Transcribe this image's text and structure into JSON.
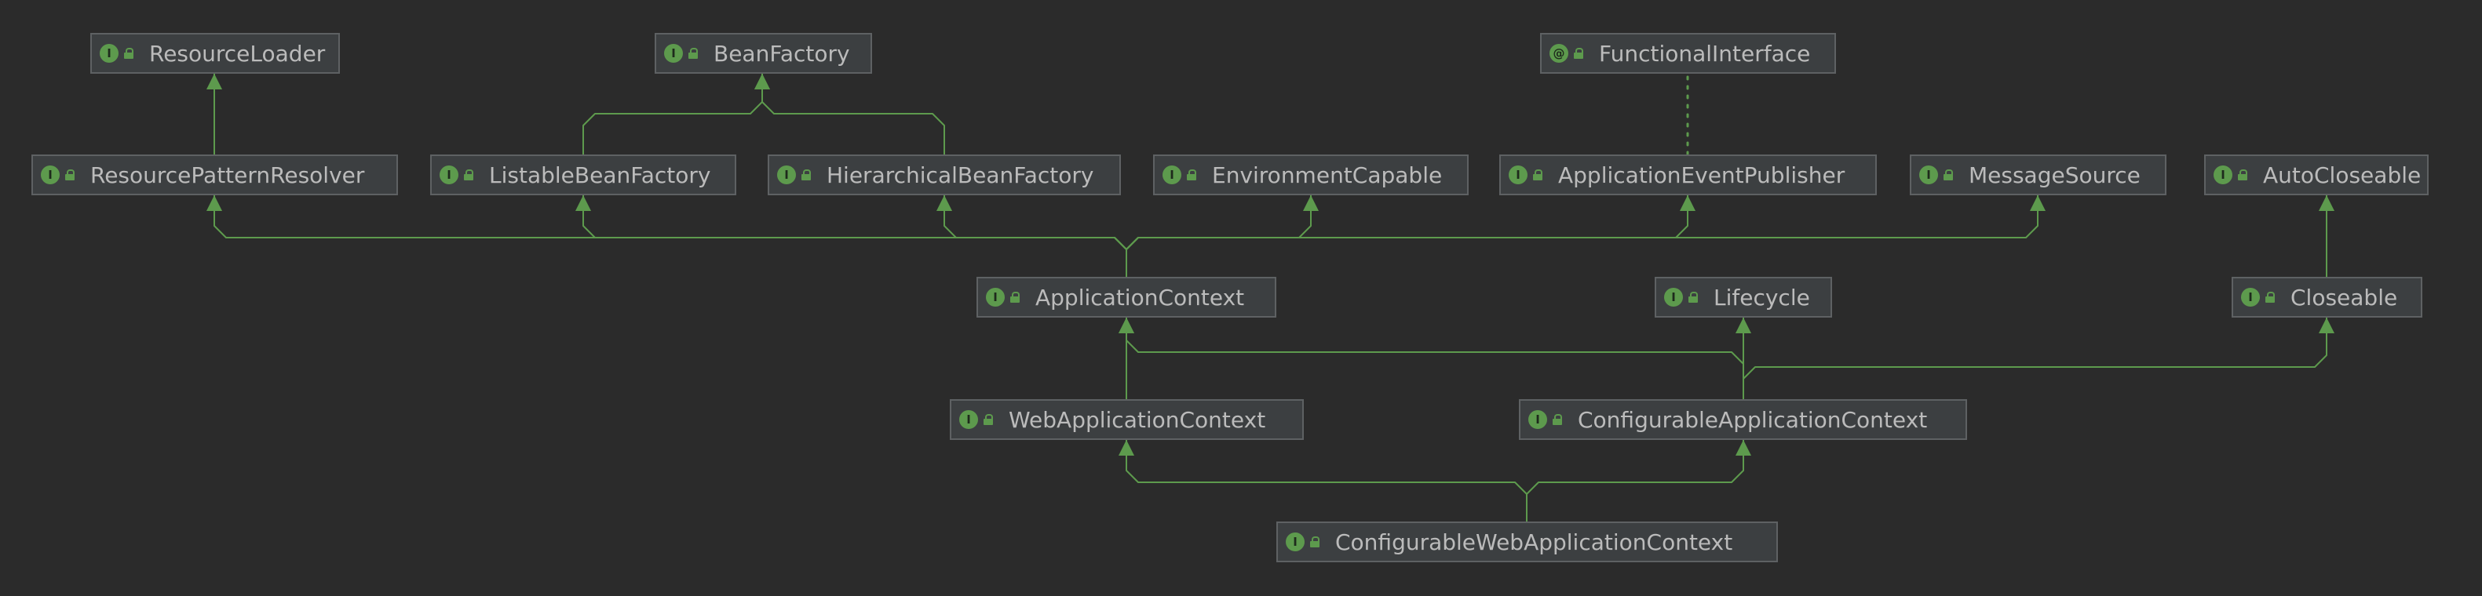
{
  "colors": {
    "background": "#2b2b2b",
    "node_fill": "#3c3f41",
    "node_border": "#5e6163",
    "text": "#bbbbbb",
    "edge": "#5d9a4d",
    "badge": "#5d9a4d"
  },
  "nodes": [
    {
      "id": "resource-loader",
      "label": "ResourceLoader",
      "badge": "I",
      "badge_icon": "interface-icon",
      "visibility_icon": "lock-icon"
    },
    {
      "id": "bean-factory",
      "label": "BeanFactory",
      "badge": "I",
      "badge_icon": "interface-icon",
      "visibility_icon": "lock-icon"
    },
    {
      "id": "functional-interface",
      "label": "FunctionalInterface",
      "badge": "@",
      "badge_icon": "annotation-icon",
      "visibility_icon": "lock-icon"
    },
    {
      "id": "resource-pattern-resolver",
      "label": "ResourcePatternResolver",
      "badge": "I",
      "badge_icon": "interface-icon",
      "visibility_icon": "lock-icon"
    },
    {
      "id": "listable-bean-factory",
      "label": "ListableBeanFactory",
      "badge": "I",
      "badge_icon": "interface-icon",
      "visibility_icon": "lock-icon"
    },
    {
      "id": "hierarchical-bean-factory",
      "label": "HierarchicalBeanFactory",
      "badge": "I",
      "badge_icon": "interface-icon",
      "visibility_icon": "lock-icon"
    },
    {
      "id": "environment-capable",
      "label": "EnvironmentCapable",
      "badge": "I",
      "badge_icon": "interface-icon",
      "visibility_icon": "lock-icon"
    },
    {
      "id": "application-event-publisher",
      "label": "ApplicationEventPublisher",
      "badge": "I",
      "badge_icon": "interface-icon",
      "visibility_icon": "lock-icon"
    },
    {
      "id": "message-source",
      "label": "MessageSource",
      "badge": "I",
      "badge_icon": "interface-icon",
      "visibility_icon": "lock-icon"
    },
    {
      "id": "auto-closeable",
      "label": "AutoCloseable",
      "badge": "I",
      "badge_icon": "interface-icon",
      "visibility_icon": "lock-icon"
    },
    {
      "id": "application-context",
      "label": "ApplicationContext",
      "badge": "I",
      "badge_icon": "interface-icon",
      "visibility_icon": "lock-icon"
    },
    {
      "id": "lifecycle",
      "label": "Lifecycle",
      "badge": "I",
      "badge_icon": "interface-icon",
      "visibility_icon": "lock-icon"
    },
    {
      "id": "closeable",
      "label": "Closeable",
      "badge": "I",
      "badge_icon": "interface-icon",
      "visibility_icon": "lock-icon"
    },
    {
      "id": "web-application-context",
      "label": "WebApplicationContext",
      "badge": "I",
      "badge_icon": "interface-icon",
      "visibility_icon": "lock-icon"
    },
    {
      "id": "configurable-application-context",
      "label": "ConfigurableApplicationContext",
      "badge": "I",
      "badge_icon": "interface-icon",
      "visibility_icon": "lock-icon"
    },
    {
      "id": "configurable-web-application-context",
      "label": "ConfigurableWebApplicationContext",
      "badge": "I",
      "badge_icon": "interface-icon",
      "visibility_icon": "lock-icon"
    }
  ],
  "edges": [
    {
      "from": "resource-pattern-resolver",
      "to": "resource-loader",
      "kind": "extends"
    },
    {
      "from": "listable-bean-factory",
      "to": "bean-factory",
      "kind": "extends"
    },
    {
      "from": "hierarchical-bean-factory",
      "to": "bean-factory",
      "kind": "extends"
    },
    {
      "from": "application-event-publisher",
      "to": "functional-interface",
      "kind": "annotated"
    },
    {
      "from": "application-context",
      "to": "resource-pattern-resolver",
      "kind": "extends"
    },
    {
      "from": "application-context",
      "to": "listable-bean-factory",
      "kind": "extends"
    },
    {
      "from": "application-context",
      "to": "hierarchical-bean-factory",
      "kind": "extends"
    },
    {
      "from": "application-context",
      "to": "environment-capable",
      "kind": "extends"
    },
    {
      "from": "application-context",
      "to": "application-event-publisher",
      "kind": "extends"
    },
    {
      "from": "application-context",
      "to": "message-source",
      "kind": "extends"
    },
    {
      "from": "closeable",
      "to": "auto-closeable",
      "kind": "extends"
    },
    {
      "from": "web-application-context",
      "to": "application-context",
      "kind": "extends"
    },
    {
      "from": "configurable-application-context",
      "to": "application-context",
      "kind": "extends"
    },
    {
      "from": "configurable-application-context",
      "to": "lifecycle",
      "kind": "extends"
    },
    {
      "from": "configurable-application-context",
      "to": "closeable",
      "kind": "extends"
    },
    {
      "from": "configurable-web-application-context",
      "to": "web-application-context",
      "kind": "extends"
    },
    {
      "from": "configurable-web-application-context",
      "to": "configurable-application-context",
      "kind": "extends"
    }
  ]
}
